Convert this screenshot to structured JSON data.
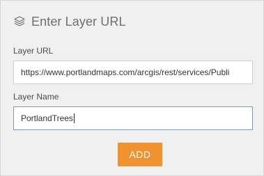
{
  "header": {
    "icon": "layers-icon",
    "title": "Enter Layer URL"
  },
  "form": {
    "layer_url": {
      "label": "Layer URL",
      "value": "https://www.portlandmaps.com/arcgis/rest/services/Publi"
    },
    "layer_name": {
      "label": "Layer Name",
      "value": "PortlandTrees"
    }
  },
  "actions": {
    "add_label": "ADD"
  },
  "colors": {
    "panel_bg": "#f0f0f0",
    "accent": "#f0922f",
    "focus_border": "#7f9bb3"
  }
}
